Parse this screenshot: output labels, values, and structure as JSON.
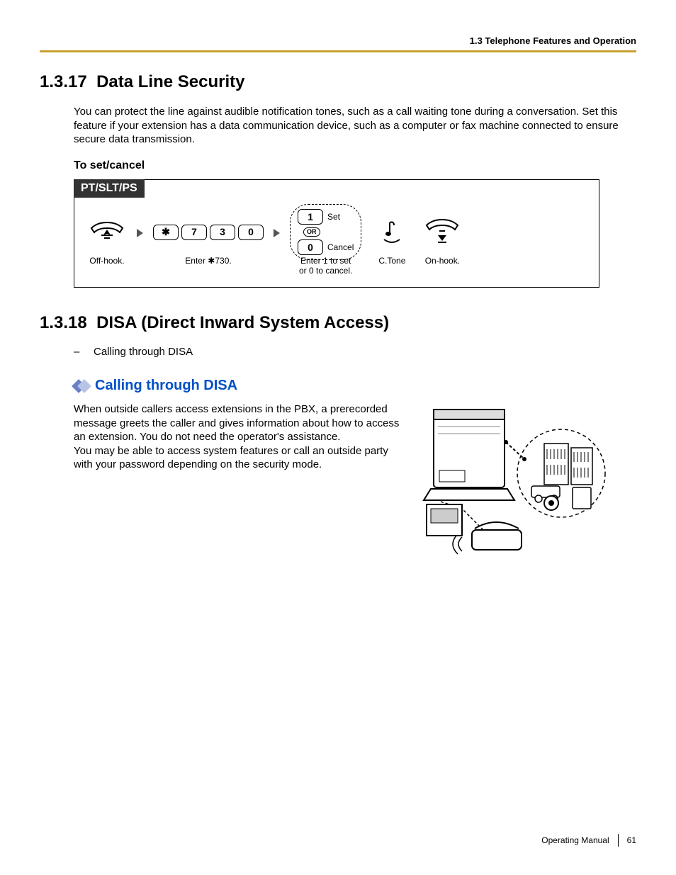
{
  "header": {
    "breadcrumb": "1.3 Telephone Features and Operation"
  },
  "section1": {
    "number": "1.3.17",
    "title": "Data Line Security",
    "body": "You can protect the line against audible notification tones, such as a call waiting tone during a conversation. Set this feature if your extension has a data communication device, such as a computer or fax machine connected to ensure secure data transmission.",
    "sub": "To set/cancel",
    "tab": "PT/SLT/PS",
    "steps": {
      "offhook": "Off-hook.",
      "enter_cmd": "Enter ✱730.",
      "keys": [
        "✱",
        "7",
        "3",
        "0"
      ],
      "set_key": "1",
      "set_label": "Set",
      "or_label": "OR",
      "cancel_key": "0",
      "cancel_label": "Cancel",
      "set_cancel_caption_line1": "Enter 1 to set",
      "set_cancel_caption_line2": "or 0 to cancel.",
      "ctone": "C.Tone",
      "onhook": "On-hook."
    }
  },
  "section2": {
    "number": "1.3.18",
    "title": "DISA (Direct Inward System Access)",
    "bullet": "Calling through DISA",
    "subhead": "Calling through DISA",
    "body1": "When outside callers access extensions in the PBX, a prerecorded message greets the caller and gives information about how to access an extension. You do not need the operator's assistance.",
    "body2": "You may be able to access system features or call an outside party with your password depending on the security mode."
  },
  "footer": {
    "manual": "Operating Manual",
    "page": "61"
  }
}
